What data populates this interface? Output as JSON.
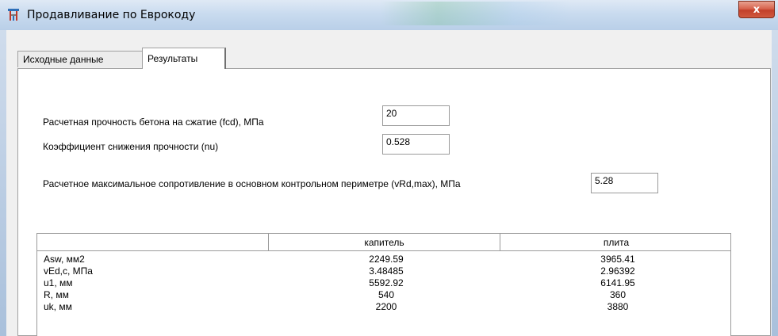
{
  "window": {
    "title": "Продавливание по Еврокоду",
    "close_label": "x"
  },
  "tabs": [
    {
      "label": "Исходные данные",
      "active": false
    },
    {
      "label": "Результаты",
      "active": true
    }
  ],
  "fields": {
    "fcd": {
      "label": "Расчетная прочность бетона на сжатие (fcd), МПа",
      "value": "20"
    },
    "nu": {
      "label": "Коэффициент снижения прочности (nu)",
      "value": "0.528"
    },
    "vrdmax": {
      "label": "Расчетное максимальное сопротивление в основном контрольном периметре (vRd,max), МПа",
      "value": "5.28"
    }
  },
  "table": {
    "columns": [
      "",
      "капитель",
      "плита"
    ],
    "rows": [
      [
        "Asw, мм2",
        "2249.59",
        "3965.41"
      ],
      [
        "vEd,c, МПа",
        "3.48485",
        "2.96392"
      ],
      [
        "u1, мм",
        "5592.92",
        "6141.95"
      ],
      [
        "R, мм",
        "540",
        "360"
      ],
      [
        "uk, мм",
        "2200",
        "3880"
      ]
    ]
  }
}
